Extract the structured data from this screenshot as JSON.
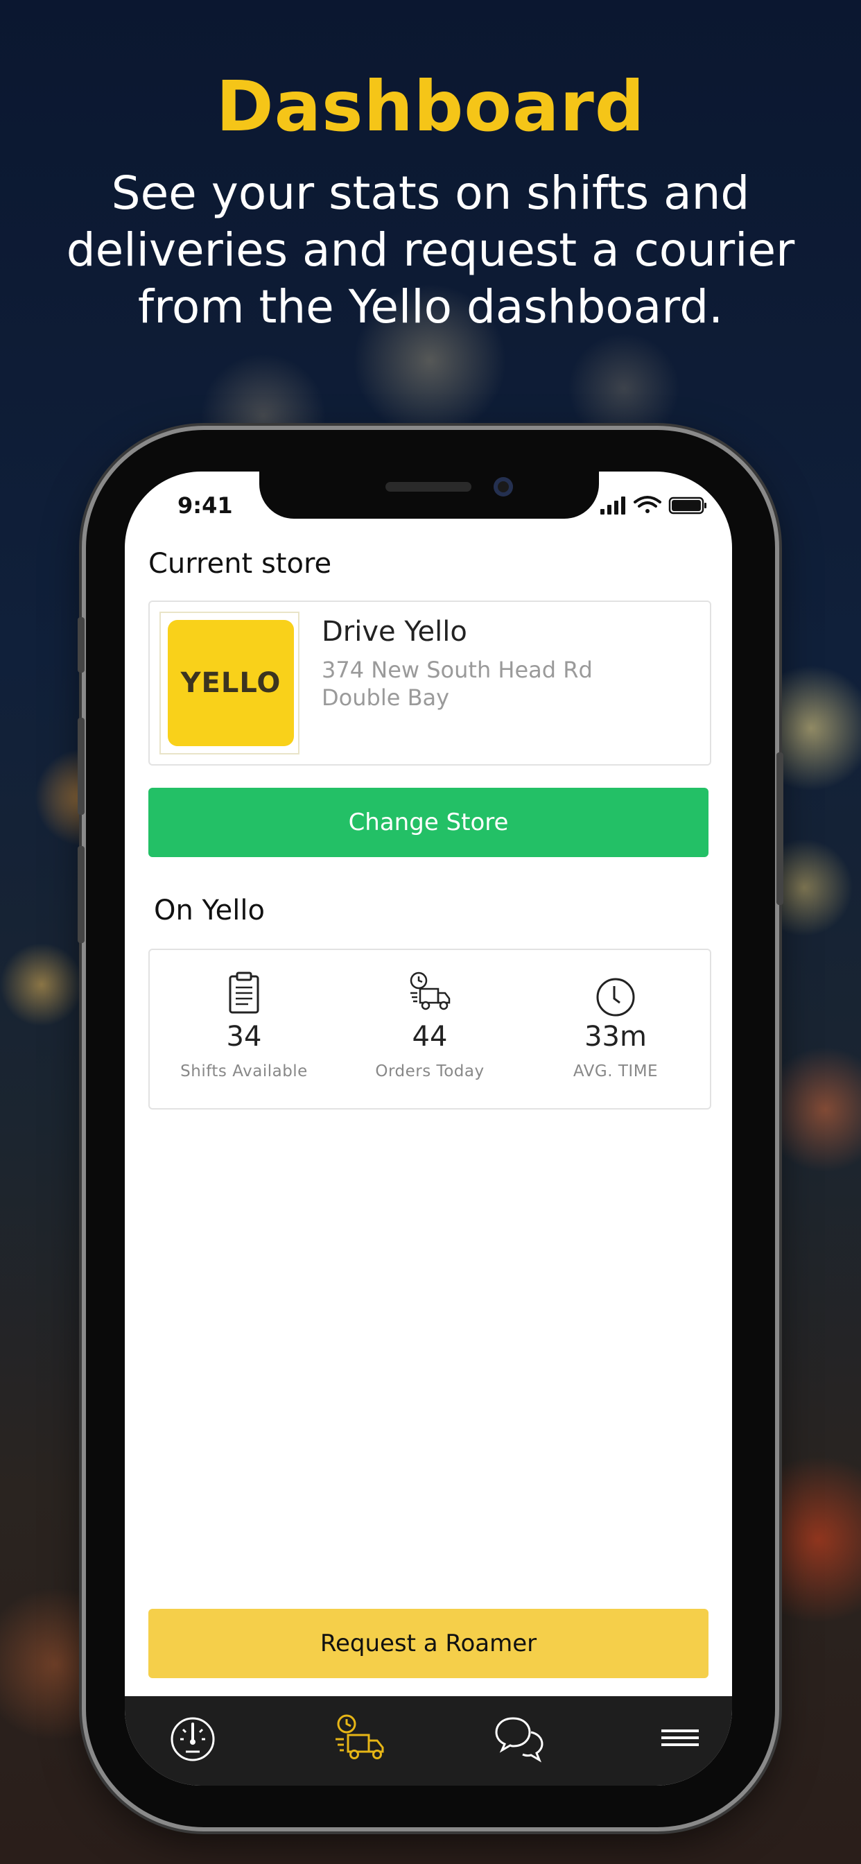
{
  "promo": {
    "headline": "Dashboard",
    "subline": "See your stats on shifts and deliveries and request a courier from the Yello dashboard."
  },
  "status_bar": {
    "time": "9:41"
  },
  "current_store": {
    "section_title": "Current store",
    "logo_text": "YELLO",
    "name": "Drive Yello",
    "address_line1": "374 New South Head Rd",
    "address_line2": "Double Bay",
    "change_button": "Change Store"
  },
  "on_yello": {
    "section_title": "On Yello",
    "stats": [
      {
        "icon": "clipboard-icon",
        "value": "34",
        "label": "Shifts Available"
      },
      {
        "icon": "delivery-truck-icon",
        "value": "44",
        "label": "Orders  Today"
      },
      {
        "icon": "clock-icon",
        "value": "33m",
        "label": "AVG. TIME"
      }
    ]
  },
  "request_button": "Request a Roamer",
  "tab_bar": {
    "items": [
      {
        "icon": "dashboard-gauge-icon",
        "active": false
      },
      {
        "icon": "delivery-truck-icon",
        "active": true
      },
      {
        "icon": "chat-bubbles-icon",
        "active": false
      },
      {
        "icon": "menu-icon",
        "active": false
      }
    ]
  },
  "colors": {
    "accent_yellow": "#f5c518",
    "green_button": "#23c066",
    "roamer_button": "#f5cf4a",
    "tab_active": "#e7b616",
    "tab_inactive": "#ffffff"
  }
}
